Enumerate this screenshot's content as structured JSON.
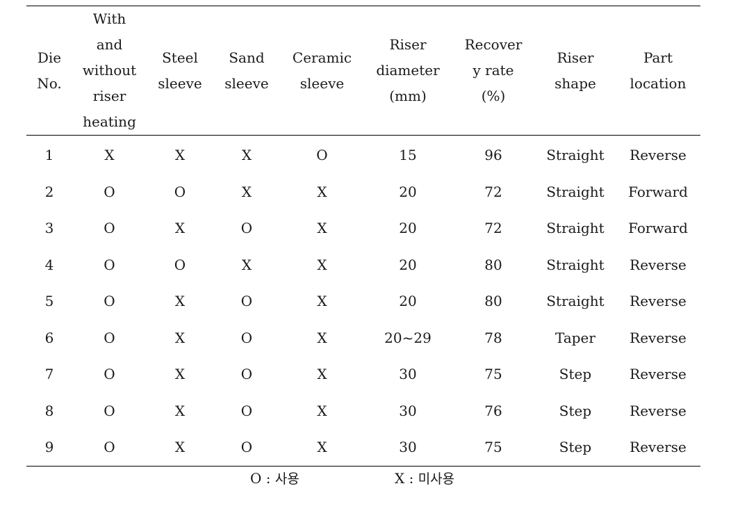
{
  "table": {
    "columns": [
      {
        "key": "die_no",
        "lines": [
          "Die",
          "No."
        ]
      },
      {
        "key": "riser_heating",
        "lines": [
          "With",
          "and",
          "without",
          "riser",
          "heating"
        ]
      },
      {
        "key": "steel_sleeve",
        "lines": [
          "Steel",
          "sleeve"
        ]
      },
      {
        "key": "sand_sleeve",
        "lines": [
          "Sand",
          "sleeve"
        ]
      },
      {
        "key": "ceramic_sleeve",
        "lines": [
          "Ceramic",
          "sleeve"
        ]
      },
      {
        "key": "riser_diameter",
        "lines": [
          "Riser",
          "diameter",
          "(mm)"
        ]
      },
      {
        "key": "recovery_rate",
        "lines": [
          "Recover",
          "y rate",
          "(%)"
        ]
      },
      {
        "key": "riser_shape",
        "lines": [
          "Riser",
          "shape"
        ]
      },
      {
        "key": "part_location",
        "lines": [
          "Part",
          "location"
        ]
      }
    ],
    "rows": [
      [
        "1",
        "X",
        "X",
        "X",
        "O",
        "15",
        "96",
        "Straight",
        "Reverse"
      ],
      [
        "2",
        "O",
        "O",
        "X",
        "X",
        "20",
        "72",
        "Straight",
        "Forward"
      ],
      [
        "3",
        "O",
        "X",
        "O",
        "X",
        "20",
        "72",
        "Straight",
        "Forward"
      ],
      [
        "4",
        "O",
        "O",
        "X",
        "X",
        "20",
        "80",
        "Straight",
        "Reverse"
      ],
      [
        "5",
        "O",
        "X",
        "O",
        "X",
        "20",
        "80",
        "Straight",
        "Reverse"
      ],
      [
        "6",
        "O",
        "X",
        "O",
        "X",
        "20~29",
        "78",
        "Taper",
        "Reverse"
      ],
      [
        "7",
        "O",
        "X",
        "O",
        "X",
        "30",
        "75",
        "Step",
        "Reverse"
      ],
      [
        "8",
        "O",
        "X",
        "O",
        "X",
        "30",
        "76",
        "Step",
        "Reverse"
      ],
      [
        "9",
        "O",
        "X",
        "O",
        "X",
        "30",
        "75",
        "Step",
        "Reverse"
      ]
    ]
  },
  "legend": {
    "used": {
      "symbol": "O",
      "sep": " : ",
      "label": "사용"
    },
    "unused": {
      "symbol": "X",
      "sep": " : ",
      "label": "미사용"
    }
  }
}
